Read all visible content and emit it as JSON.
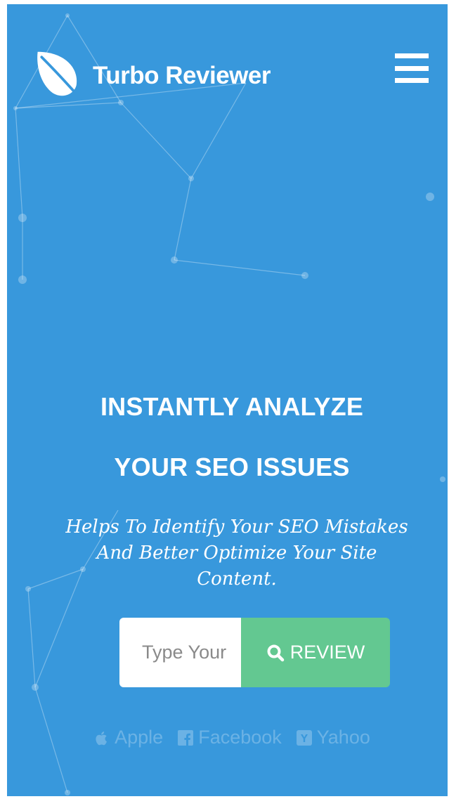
{
  "header": {
    "brand": "Turbo Reviewer",
    "logo_icon": "leaf-icon",
    "menu_icon": "hamburger-icon"
  },
  "hero": {
    "headline_line1": "INSTANTLY ANALYZE",
    "headline_line2": "YOUR SEO ISSUES",
    "tagline_line1": "Helps To Identify Your SEO Mistakes",
    "tagline_line2": "And Better Optimize Your Site",
    "tagline_line3": "Content."
  },
  "search": {
    "placeholder": "Type Your URL",
    "button_label": "REVIEW",
    "button_icon": "search-icon"
  },
  "providers": [
    {
      "label": "Apple",
      "icon": "apple-icon"
    },
    {
      "label": "Facebook",
      "icon": "facebook-icon"
    },
    {
      "label": "Yahoo",
      "icon": "yahoo-icon"
    }
  ],
  "colors": {
    "background": "#3898dc",
    "accent": "#63c891",
    "text": "#ffffff"
  }
}
